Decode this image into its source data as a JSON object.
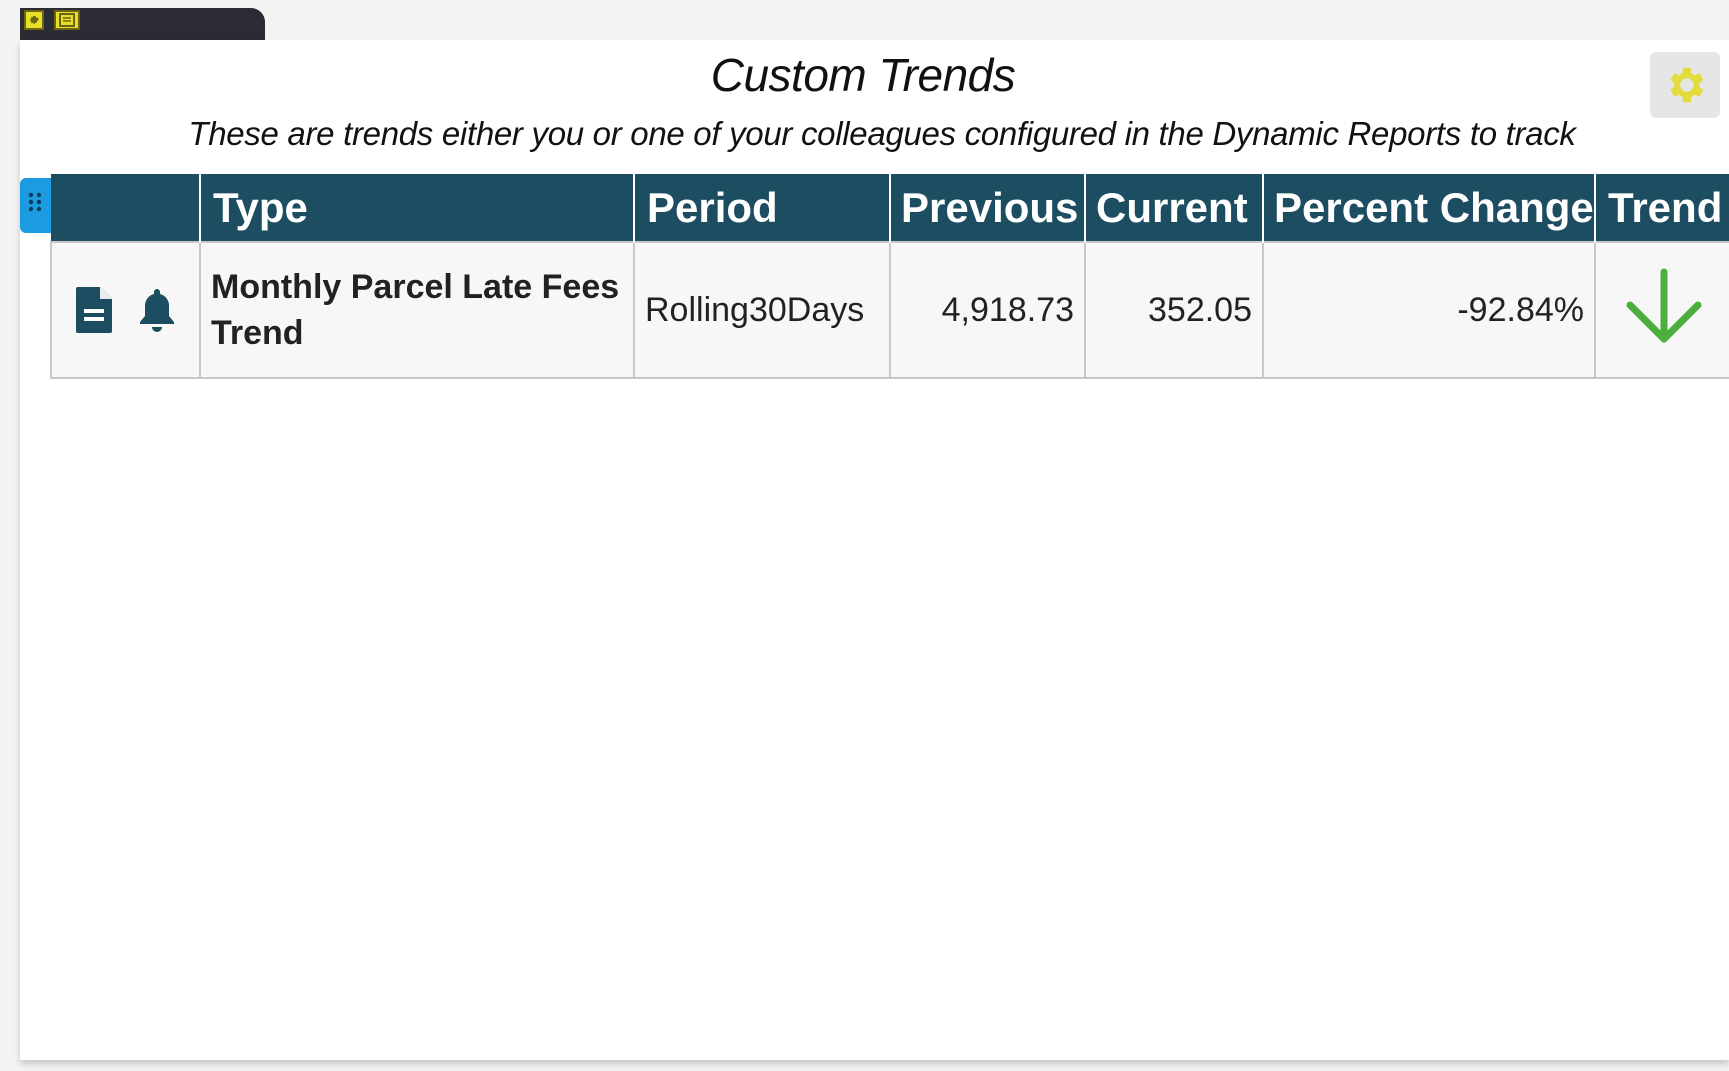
{
  "colors": {
    "header_bg": "#1c4d61",
    "accent": "#1c9be0",
    "trend_down": "#4caf3d",
    "gear": "#e2dd3c"
  },
  "top_tab": {
    "icons": [
      "gear-icon",
      "window-icon"
    ]
  },
  "widget": {
    "title": "Custom Trends",
    "subtitle": "These are trends either you or one of your colleagues configured in the Dynamic Reports to track",
    "settings_icon": "gear-icon"
  },
  "table": {
    "headers": {
      "actions": "",
      "type": "Type",
      "period": "Period",
      "previous": "Previous",
      "current": "Current",
      "percent_change": "Percent Change",
      "trend": "Trend"
    },
    "rows": [
      {
        "actions": [
          "document-icon",
          "bell-icon"
        ],
        "type": "Monthly Parcel Late Fees Trend",
        "period": "Rolling30Days",
        "previous": "4,918.73",
        "current": "352.05",
        "percent_change": "-92.84%",
        "trend": "down-arrow-icon"
      }
    ]
  }
}
